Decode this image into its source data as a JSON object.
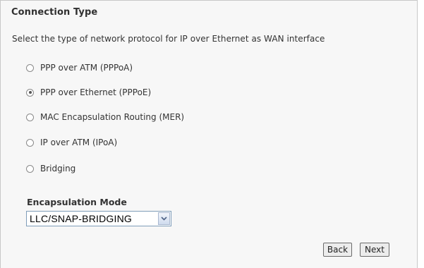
{
  "section": {
    "title": "Connection Type",
    "description": "Select the type of network protocol for IP over Ethernet as WAN interface"
  },
  "protocols": [
    {
      "label": "PPP over ATM (PPPoA)",
      "checked": false
    },
    {
      "label": "PPP over Ethernet (PPPoE)",
      "checked": true
    },
    {
      "label": "MAC Encapsulation Routing (MER)",
      "checked": false
    },
    {
      "label": "IP over ATM (IPoA)",
      "checked": false
    },
    {
      "label": "Bridging",
      "checked": false
    }
  ],
  "encapsulation": {
    "label": "Encapsulation Mode",
    "selected": "LLC/SNAP-BRIDGING"
  },
  "buttons": {
    "back": "Back",
    "next": "Next"
  },
  "icons": {
    "dropdown": "chevron-down-icon"
  }
}
